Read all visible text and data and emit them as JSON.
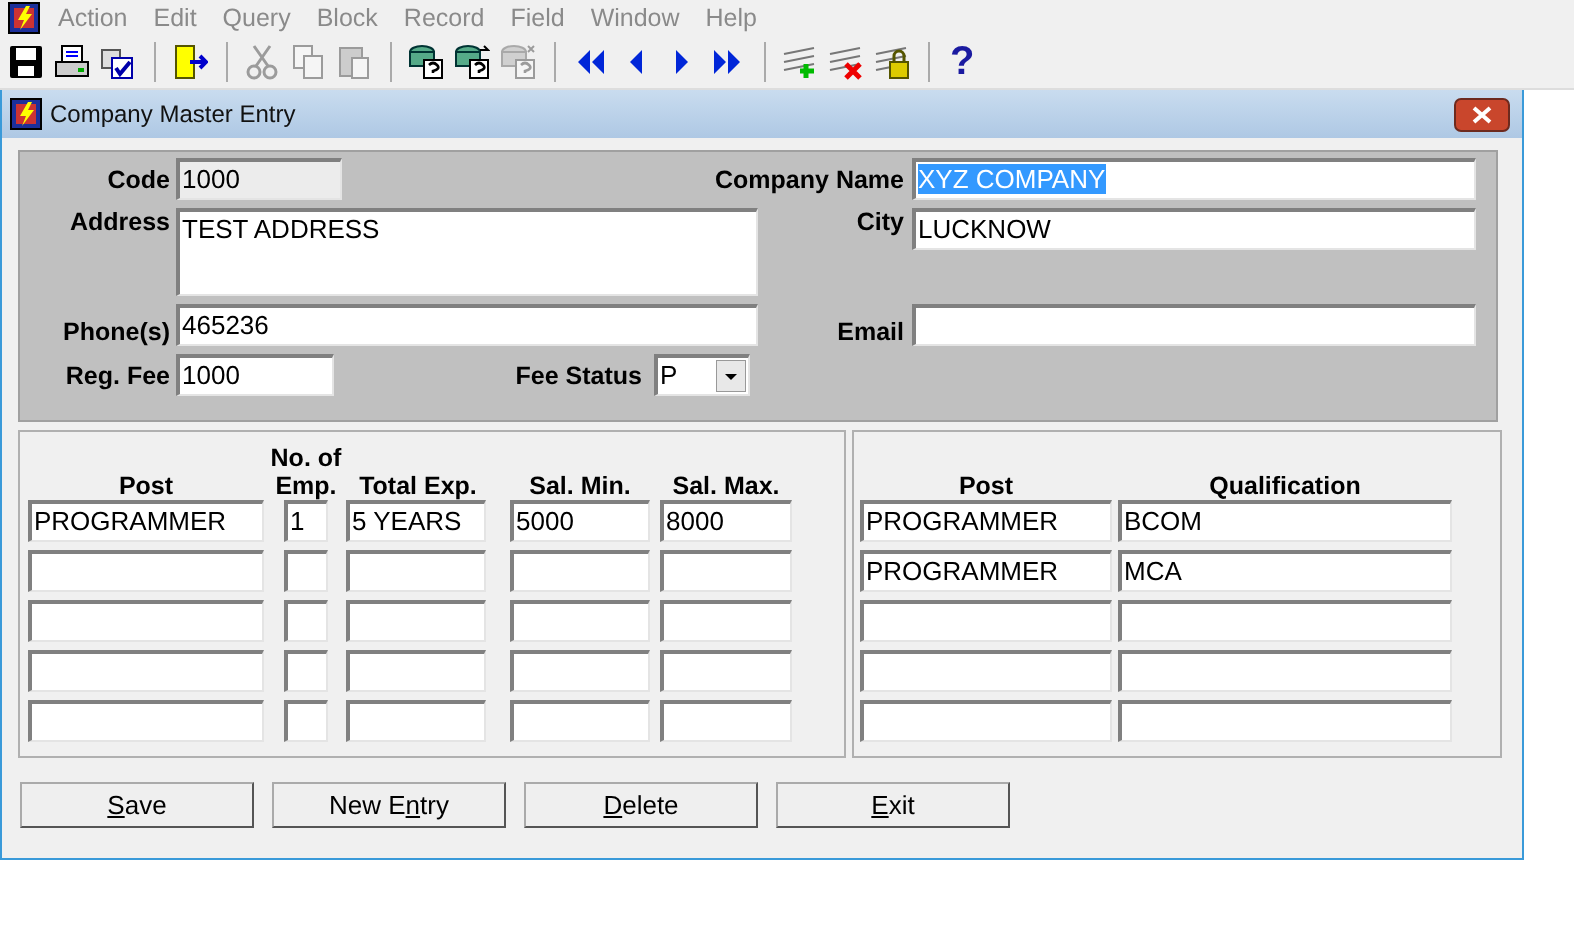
{
  "menu_bar": {
    "items": [
      "Action",
      "Edit",
      "Query",
      "Block",
      "Record",
      "Field",
      "Window",
      "Help"
    ]
  },
  "toolbar": {
    "groups": [
      [
        {
          "kind": "save",
          "disabled": false
        },
        {
          "kind": "print",
          "disabled": false
        },
        {
          "kind": "check",
          "disabled": false
        }
      ],
      [
        {
          "kind": "exit",
          "disabled": false
        }
      ],
      [
        {
          "kind": "cut",
          "disabled": true
        },
        {
          "kind": "copy",
          "disabled": true
        },
        {
          "kind": "paste",
          "disabled": true
        }
      ],
      [
        {
          "kind": "query-enter",
          "disabled": false
        },
        {
          "kind": "query-execute",
          "disabled": false
        },
        {
          "kind": "query-cancel",
          "disabled": true
        }
      ],
      [
        {
          "kind": "first",
          "disabled": false
        },
        {
          "kind": "prev",
          "disabled": false
        },
        {
          "kind": "next",
          "disabled": false
        },
        {
          "kind": "last",
          "disabled": false
        }
      ],
      [
        {
          "kind": "insert",
          "disabled": false
        },
        {
          "kind": "remove",
          "disabled": false
        },
        {
          "kind": "lock",
          "disabled": false
        }
      ],
      [
        {
          "kind": "help",
          "disabled": false,
          "label": "?"
        }
      ]
    ]
  },
  "window": {
    "title": "Company Master Entry"
  },
  "header": {
    "code": {
      "label": "Code",
      "value": "1000",
      "readonly": true
    },
    "company_name": {
      "label": "Company Name",
      "value": "XYZ COMPANY",
      "text_selected": true
    },
    "address": {
      "label": "Address",
      "value": "TEST ADDRESS"
    },
    "city": {
      "label": "City",
      "value": "LUCKNOW"
    },
    "phone": {
      "label": "Phone(s)",
      "value": "465236"
    },
    "email": {
      "label": "Email"
    },
    "reg_fee": {
      "label": "Reg. Fee",
      "value": "1000"
    },
    "fee_status": {
      "label": "Fee Status",
      "value": "P"
    }
  },
  "posts_table": {
    "columns": [
      "Post",
      "No. of Emp.",
      "Total Exp.",
      "Sal. Min.",
      "Sal. Max."
    ],
    "rows": [
      [
        "PROGRAMMER",
        "1",
        "5 YEARS",
        "5000",
        "8000"
      ],
      [],
      [],
      [],
      []
    ]
  },
  "qualifications_table": {
    "columns": [
      "Post",
      "Qualification"
    ],
    "rows": [
      [
        "PROGRAMMER",
        "BCOM"
      ],
      [
        "PROGRAMMER",
        "MCA"
      ],
      [],
      [],
      []
    ]
  },
  "buttons": [
    {
      "access_key": "S",
      "after": "ave"
    },
    {
      "before": "New E",
      "access_key": "n",
      "after": "try"
    },
    {
      "access_key": "D",
      "after": "elete"
    },
    {
      "access_key": "E",
      "after": "xit"
    }
  ]
}
